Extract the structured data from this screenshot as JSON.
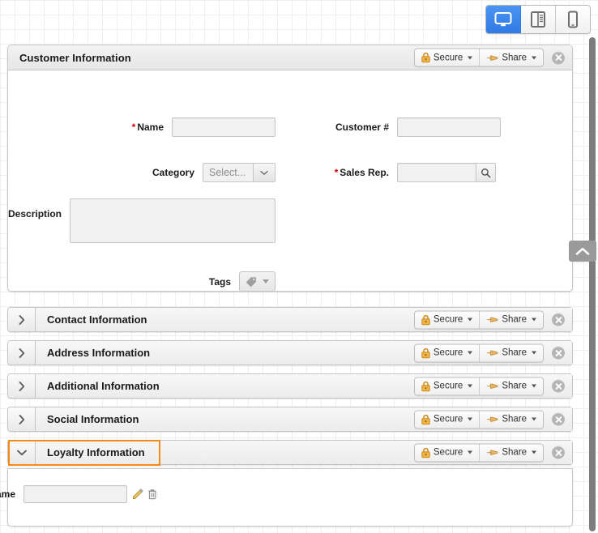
{
  "device_toolbar": {
    "options": [
      {
        "name": "desktop",
        "icon": "desktop-icon",
        "active": true
      },
      {
        "name": "tablet",
        "icon": "tablet-icon",
        "active": false
      },
      {
        "name": "mobile",
        "icon": "mobile-icon",
        "active": false
      }
    ]
  },
  "header_controls": {
    "secure_label": "Secure",
    "share_label": "Share",
    "secure_icon": "padlock-icon",
    "share_icon": "pointing-hand-icon",
    "close_icon": "close-icon"
  },
  "main_panel": {
    "title": "Customer Information",
    "fields": {
      "name": {
        "label": "Name",
        "required": true,
        "value": "",
        "placeholder": ""
      },
      "customer_number": {
        "label": "Customer #",
        "required": false,
        "value": "",
        "placeholder": ""
      },
      "category": {
        "label": "Category",
        "required": false,
        "value": "Select...",
        "placeholder": "Select...",
        "icon": "chevron-down-icon"
      },
      "sales_rep": {
        "label": "Sales Rep.",
        "required": true,
        "value": "",
        "placeholder": "",
        "icon": "search-icon"
      },
      "description": {
        "label": "Description",
        "required": false,
        "value": "",
        "placeholder": ""
      },
      "tags": {
        "label": "Tags",
        "value": "",
        "icon": "tag-icon",
        "caret": "chevron-down-icon"
      }
    }
  },
  "sections": [
    {
      "title": "Contact Information",
      "expanded": false,
      "toggle_icon": "chevron-right-icon",
      "selected": false
    },
    {
      "title": "Address Information",
      "expanded": false,
      "toggle_icon": "chevron-right-icon",
      "selected": false
    },
    {
      "title": "Additional Information",
      "expanded": false,
      "toggle_icon": "chevron-right-icon",
      "selected": false
    },
    {
      "title": "Social Information",
      "expanded": false,
      "toggle_icon": "chevron-right-icon",
      "selected": false
    },
    {
      "title": "Loyalty Information",
      "expanded": true,
      "toggle_icon": "chevron-down-icon",
      "selected": true
    }
  ],
  "loyalty_panel": {
    "fields": {
      "program_name": {
        "label": "Program Name",
        "value": "",
        "placeholder": ""
      }
    },
    "row_actions": {
      "edit_icon": "pencil-edit-icon",
      "delete_icon": "trash-delete-icon"
    }
  },
  "colors": {
    "accent_selected": "#f28c18",
    "active_device": "#2f7ae5",
    "required_marker": "#d40000",
    "lock_icon": "#e8a33d",
    "panel_border": "#c8c8c8",
    "input_fill": "#f1f1f1"
  },
  "edge_controls": {
    "collapse_icon": "chevron-up-icon",
    "scrollbar": "vertical-scrollbar"
  }
}
